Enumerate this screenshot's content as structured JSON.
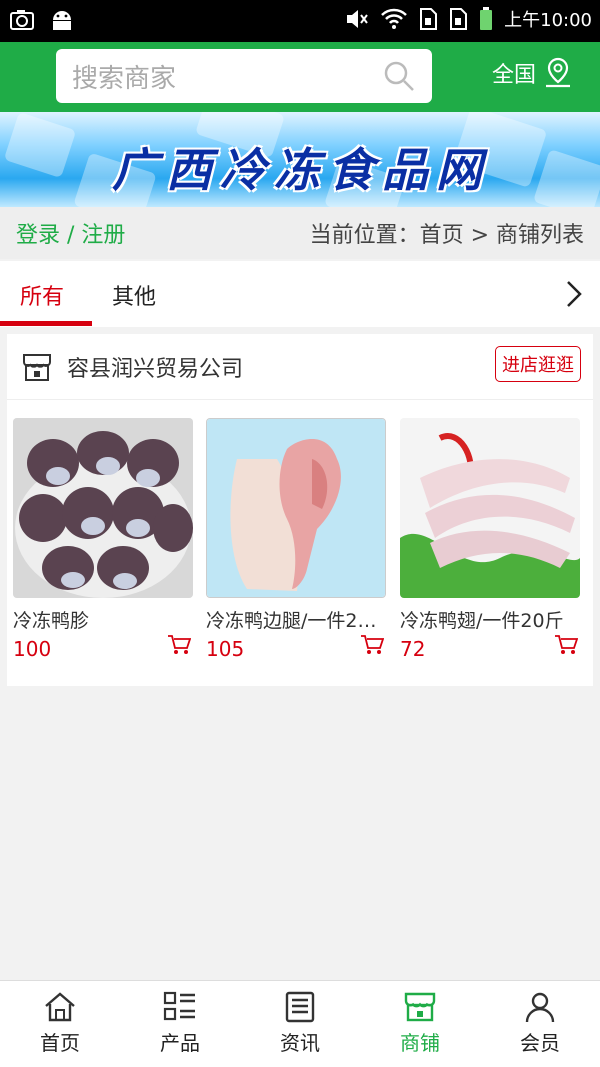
{
  "status_bar": {
    "time": "上午10:00",
    "icons": [
      "camera-icon",
      "android-icon",
      "mute-icon",
      "wifi-icon",
      "sim-icon",
      "sim-icon",
      "battery-icon"
    ]
  },
  "header": {
    "search_placeholder": "搜索商家",
    "region": "全国",
    "accent_color": "#1fac47"
  },
  "banner": {
    "title": "广西冷冻食品网"
  },
  "crumb": {
    "login": "登录",
    "separator": " / ",
    "register": "注册",
    "location": "当前位置：首页 > 商铺列表"
  },
  "tabs": {
    "items": [
      {
        "label": "所有",
        "active": true
      },
      {
        "label": "其他",
        "active": false
      }
    ]
  },
  "shop": {
    "name": "容县润兴贸易公司",
    "enter_label": "进店逛逛",
    "products": [
      {
        "name": "冷冻鸭胗",
        "price": "100"
      },
      {
        "name": "冷冻鸭边腿/一件2…",
        "price": "105"
      },
      {
        "name": "冷冻鸭翅/一件20斤",
        "price": "72"
      }
    ]
  },
  "bottom_nav": {
    "items": [
      {
        "label": "首页",
        "icon": "home-icon"
      },
      {
        "label": "产品",
        "icon": "list-icon"
      },
      {
        "label": "资讯",
        "icon": "news-icon"
      },
      {
        "label": "商铺",
        "icon": "shop-icon",
        "active": true
      },
      {
        "label": "会员",
        "icon": "user-icon"
      }
    ]
  },
  "colors": {
    "primary": "#1fac47",
    "price": "#d6000f"
  }
}
